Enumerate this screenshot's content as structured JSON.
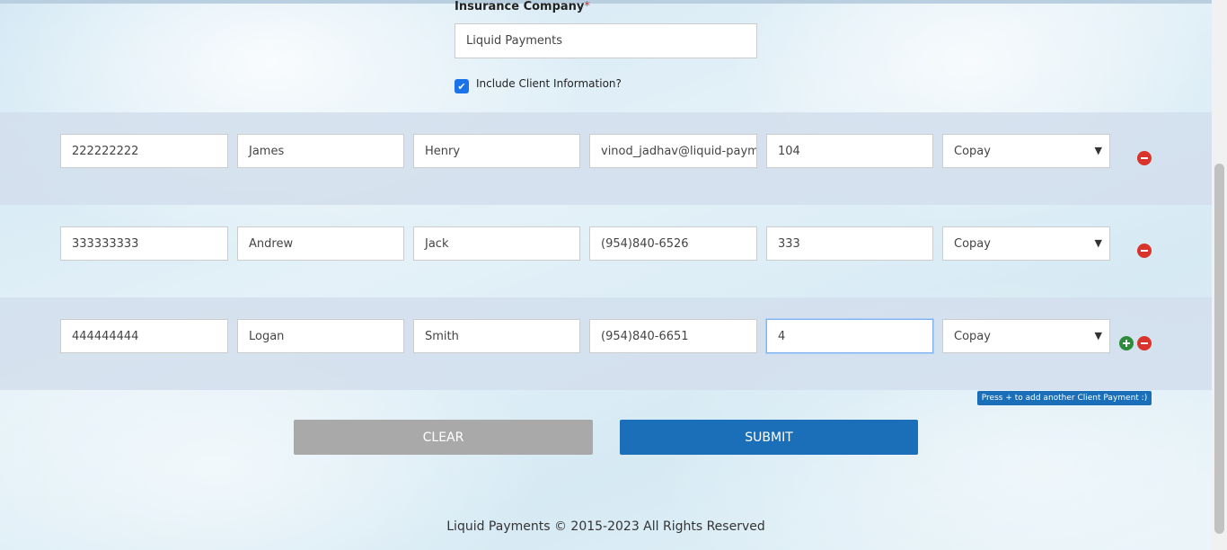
{
  "form": {
    "insurance_label": "Insurance Company",
    "required_mark": "*",
    "insurance_value": "Liquid Payments",
    "include_client_label": "Include Client Information?",
    "include_client_checked": true
  },
  "rows": [
    {
      "id": "222222222",
      "first_name": "James",
      "last_name": "Henry",
      "contact": "vinod_jadhav@liquid-payments.com",
      "amount": "104",
      "type": "Copay"
    },
    {
      "id": "333333333",
      "first_name": "Andrew",
      "last_name": "Jack",
      "contact": "(954)840-6526",
      "amount": "333",
      "type": "Copay"
    },
    {
      "id": "444444444",
      "first_name": "Logan",
      "last_name": "Smith",
      "contact": "(954)840-6651",
      "amount": "4",
      "type": "Copay"
    }
  ],
  "tooltip": "Press + to add another Client Payment :)",
  "buttons": {
    "clear": "CLEAR",
    "submit": "SUBMIT"
  },
  "footer": "Liquid Payments © 2015-2023 All Rights Reserved",
  "colors": {
    "primary": "#1a6fb8",
    "clear_button": "#a9a9a9",
    "remove_icon": "#d9342b",
    "add_icon": "#2e8b3a",
    "required": "#d32f2f"
  },
  "icons": {
    "remove": "minus-circle-icon",
    "add": "plus-circle-icon",
    "checkbox": "checkmark-icon",
    "select": "chevron-down-icon"
  }
}
